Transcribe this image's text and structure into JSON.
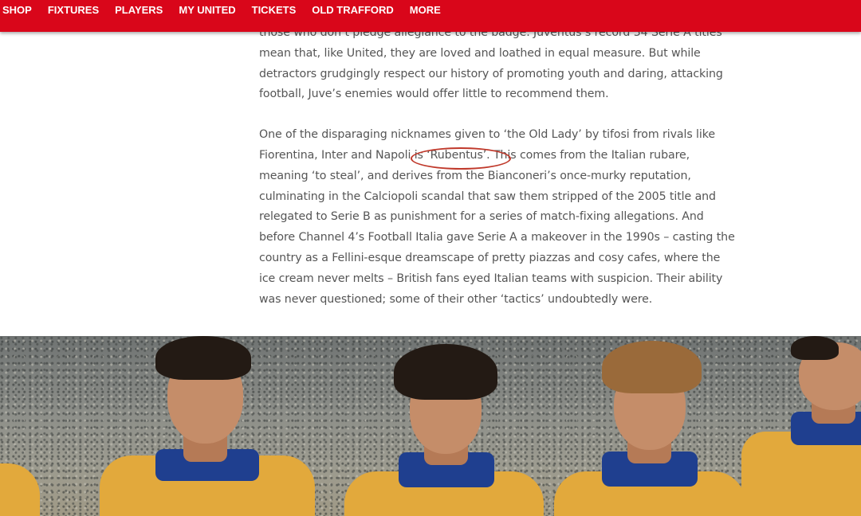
{
  "nav": {
    "items": [
      "SHOP",
      "FIXTURES",
      "PLAYERS",
      "MY UNITED",
      "TICKETS",
      "OLD TRAFFORD",
      "MORE"
    ]
  },
  "article": {
    "para1_lines": [
      "those who don’t pledge allegiance to the badge. Juventus’s record 34 Serie A titles",
      "mean that, like United, they are loved and loathed in equal measure. But while",
      "detractors grudgingly respect our history of promoting youth and daring, attacking",
      "football, Juve’s enemies would offer little to recommend them."
    ],
    "para2_line1": "One of the disparaging nicknames given to ‘the Old Lady’ by tifosi from rivals like",
    "para2_line2_before": "Fiorentina, Inter and Napoli ",
    "para2_line2_circled": "is ‘Rubentus’.",
    "para2_line2_after": " This comes from the Italian rubare,",
    "para2_rest": [
      "meaning ‘to steal’, and derives from the Bianconeri’s once-murky reputation,",
      "culminating in the Calciopoli scandal that saw them stripped of the 2005 title and",
      "relegated to Serie B as punishment for a series of match-fixing allegations. And",
      "before Channel 4’s Football Italia gave Serie A a makeover in the 1990s – casting the",
      "country as a Fellini-esque dreamscape of pretty piazzas and cosy cafes, where the",
      "ice cream never melts – British fans eyed Italian teams with suspicion. Their ability",
      "was never questioned; some of their other ‘tactics’ undoubtedly were."
    ]
  },
  "colors": {
    "nav_background": "#d9061a",
    "annotation_ring": "#c0392b",
    "body_text": "#555555",
    "shirt_yellow": "#e2a93c",
    "collar_blue": "#1f3f8f"
  }
}
